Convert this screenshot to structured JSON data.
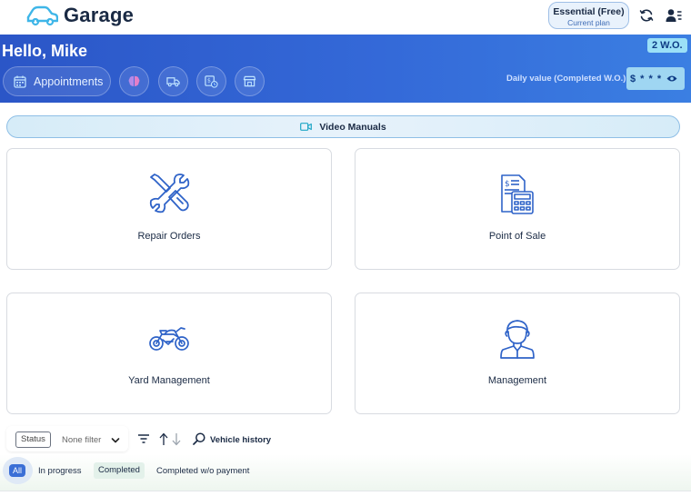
{
  "app": {
    "name": "Garage"
  },
  "plan": {
    "name": "Essential (Free)",
    "subtitle": "Current plan"
  },
  "header": {
    "greeting": "Hello, Mike",
    "wo_badge": "2 W.O.",
    "appointments_label": "Appointments",
    "daily_value_label": "Daily value (Completed W.O.)",
    "daily_value": "$ * * *"
  },
  "video_manuals": {
    "label": "Video Manuals"
  },
  "cards": [
    {
      "label": "Repair Orders",
      "icon": "tools-icon"
    },
    {
      "label": "Point of Sale",
      "icon": "pos-icon"
    },
    {
      "label": "Yard Management",
      "icon": "motorcycle-icon"
    },
    {
      "label": "Management",
      "icon": "manager-icon"
    }
  ],
  "filters": {
    "status_label": "Status",
    "status_value": "None filter",
    "vehicle_history_label": "Vehicle history"
  },
  "tabs": [
    {
      "label": "All",
      "active": true
    },
    {
      "label": "In progress",
      "active": false
    },
    {
      "label": "Completed",
      "active": false
    },
    {
      "label": "Completed w/o payment",
      "active": false
    }
  ],
  "colors": {
    "brand_blue": "#2b56c7",
    "accent_cyan": "#9be0f7",
    "icon_blue": "#2f63c8"
  }
}
